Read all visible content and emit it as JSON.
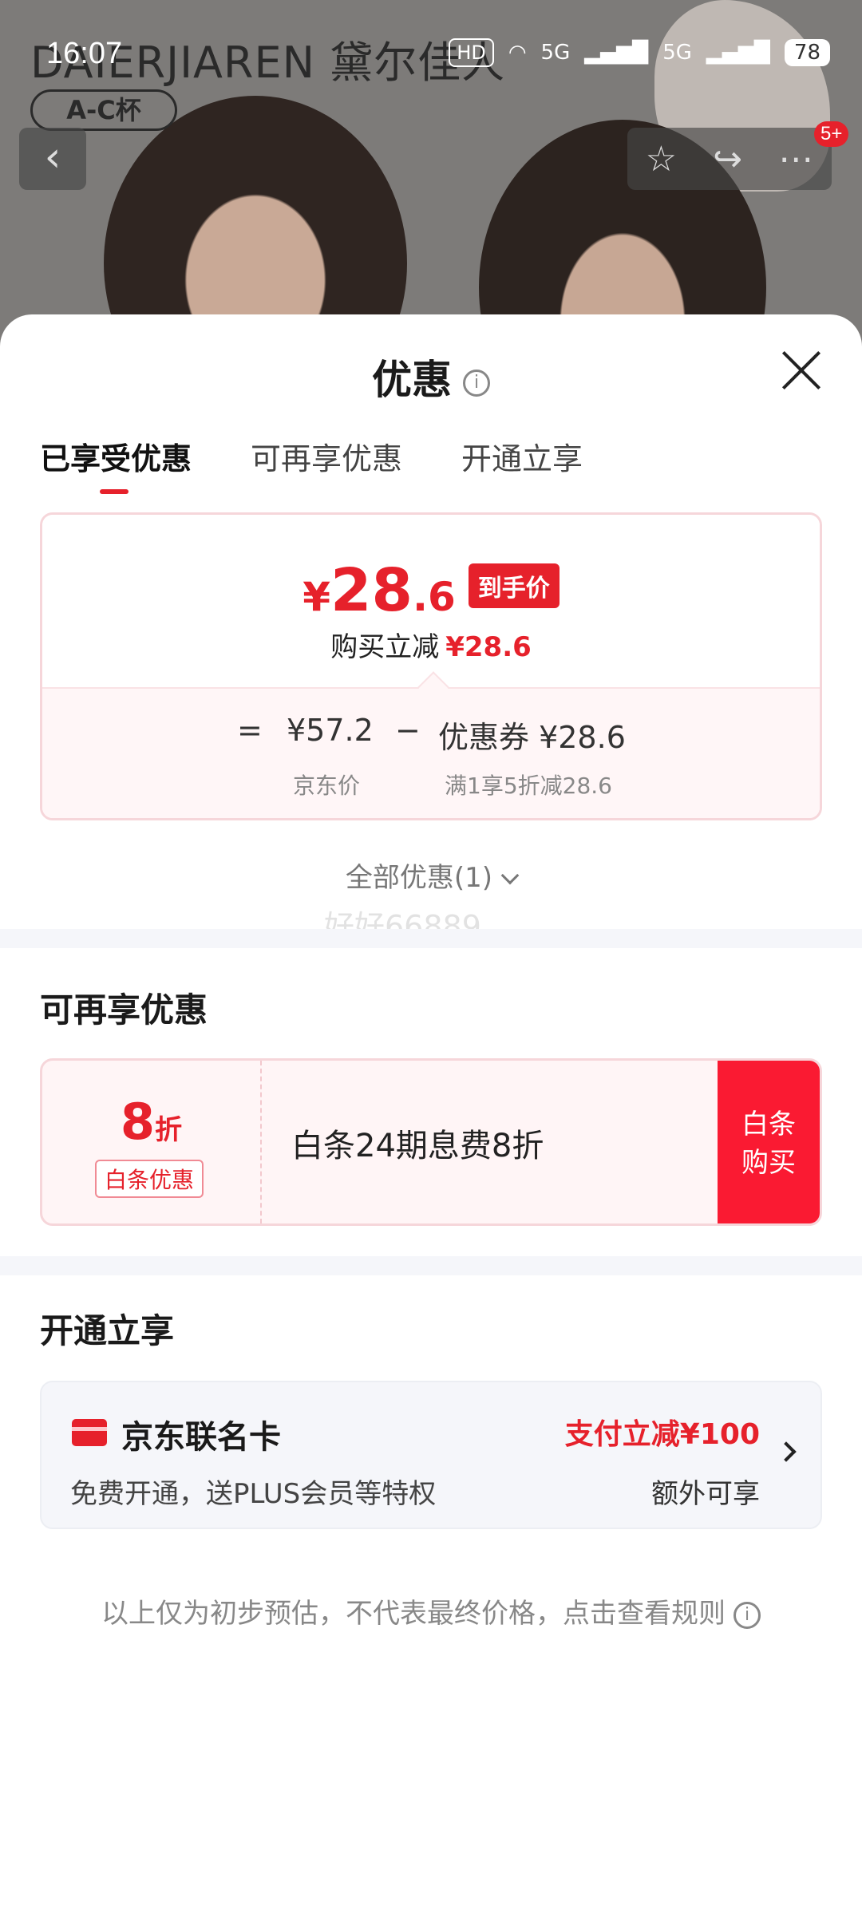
{
  "status_bar": {
    "time": "16:07",
    "hd_label": "HD",
    "net1": "5G",
    "net2": "5G",
    "battery": "78"
  },
  "hero": {
    "brand_text": "DAIERJIAREN 黛尔佳人",
    "cup_label": "A-C杯",
    "cart_badge": "5+"
  },
  "sheet": {
    "title": "优惠",
    "tabs": [
      "已享受优惠",
      "可再享优惠",
      "开通立享"
    ]
  },
  "price_card": {
    "yen": "¥",
    "price_int": "28",
    "price_dec": ".6",
    "hand_price_label": "到手价",
    "reduce_label": "购买立减",
    "reduce_amount": "¥28.6",
    "equals": "=",
    "jd_price": "¥57.2",
    "minus": "−",
    "coupon_label": "优惠券 ¥28.6",
    "jd_price_caption": "京东价",
    "coupon_caption": "满1享5折减28.6"
  },
  "all_discounts": "全部优惠(1)",
  "watermark": "好好66889",
  "more_section": {
    "title": "可再享优惠",
    "discount_num": "8",
    "discount_unit": "折",
    "tag": "白条优惠",
    "description": "白条24期息费8折",
    "buy_button_line1": "白条",
    "buy_button_line2": "购买"
  },
  "open_section": {
    "title": "开通立享",
    "card_name": "京东联名卡",
    "card_sub": "免费开通，送PLUS会员等特权",
    "promo": "支付立减¥100",
    "extra": "额外可享"
  },
  "footnote": "以上仅为初步预估，不代表最终价格，点击查看规则",
  "colors": {
    "accent": "#e6212b",
    "coupon_bg": "#fff5f6",
    "divider": "#f5f6fa"
  }
}
